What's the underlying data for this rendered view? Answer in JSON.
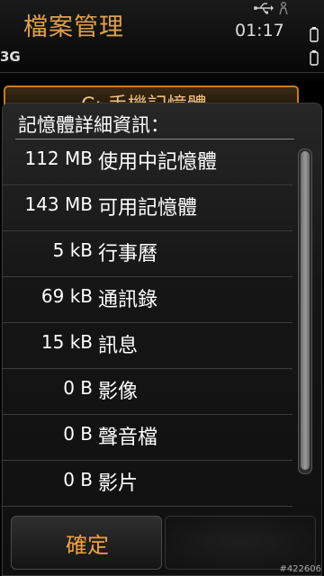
{
  "status_bar": {
    "app_title": "檔案管理",
    "clock": "01:17",
    "network": "3G"
  },
  "background": {
    "list_item": "C: 手機記憶體"
  },
  "dialog": {
    "title": "記憶體詳細資訊：",
    "rows": [
      {
        "size": "112 MB",
        "label": "使用中記憶體"
      },
      {
        "size": "143 MB",
        "label": "可用記憶體"
      },
      {
        "size": "5 kB",
        "label": "行事曆"
      },
      {
        "size": "69 kB",
        "label": "通訊錄"
      },
      {
        "size": "15 kB",
        "label": "訊息"
      },
      {
        "size": "0 B",
        "label": "影像"
      },
      {
        "size": "0 B",
        "label": "聲音檔"
      },
      {
        "size": "0 B",
        "label": "影片"
      }
    ],
    "ok_label": "確定"
  },
  "watermark": "#422606",
  "colors": {
    "accent": "#f0a040",
    "title": "#e0a050"
  }
}
